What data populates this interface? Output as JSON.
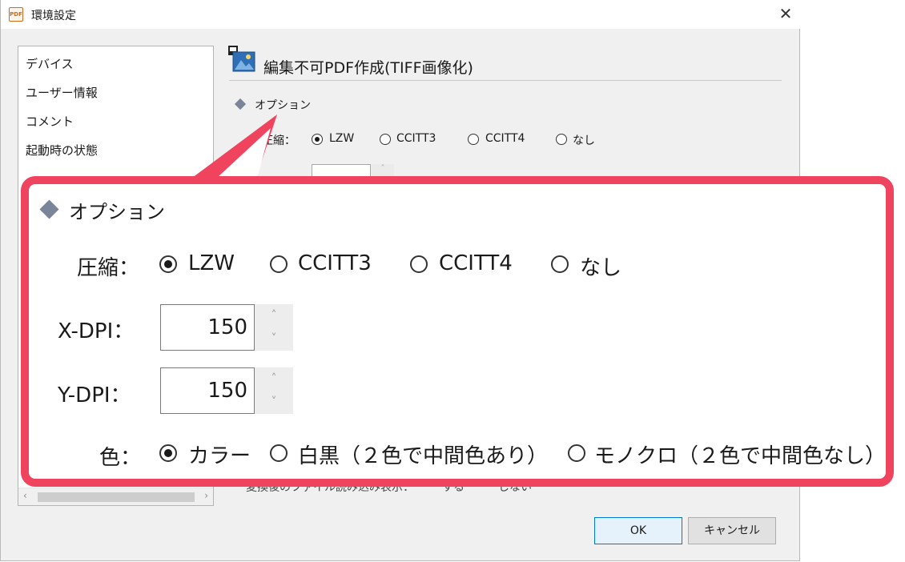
{
  "window": {
    "title": "環境設定",
    "app_icon_text": "PDF",
    "close_glyph": "✕"
  },
  "sidebar": {
    "items": [
      {
        "label": "デバイス"
      },
      {
        "label": "ユーザー情報"
      },
      {
        "label": "コメント"
      },
      {
        "label": "起動時の状態"
      }
    ],
    "scroll_left": "‹",
    "scroll_right": "›"
  },
  "panel": {
    "section_title": "編集不可PDF作成(TIFF画像化)",
    "option_heading": "オプション",
    "compression_label": "圧縮：",
    "compression_options": [
      "LZW",
      "CCITT3",
      "CCITT4",
      "なし"
    ],
    "compression_selected": "LZW",
    "clipped_row_text": "変換後のファイル読み込み表示：　　　する　　　しない"
  },
  "callout": {
    "option_heading": "オプション",
    "compression": {
      "label": "圧縮：",
      "options": [
        "LZW",
        "CCITT3",
        "CCITT4",
        "なし"
      ],
      "selected": "LZW"
    },
    "x_dpi": {
      "label": "X-DPI：",
      "value": "150"
    },
    "y_dpi": {
      "label": "Y-DPI：",
      "value": "150"
    },
    "color": {
      "label": "色：",
      "options": [
        "カラー",
        "白黒（２色で中間色あり）",
        "モノクロ（２色で中間色なし）"
      ],
      "selected": "カラー"
    },
    "spin_up": "˄",
    "spin_down": "˅",
    "border_color": "#f0445e"
  },
  "buttons": {
    "ok": "OK",
    "cancel": "キャンセル"
  }
}
